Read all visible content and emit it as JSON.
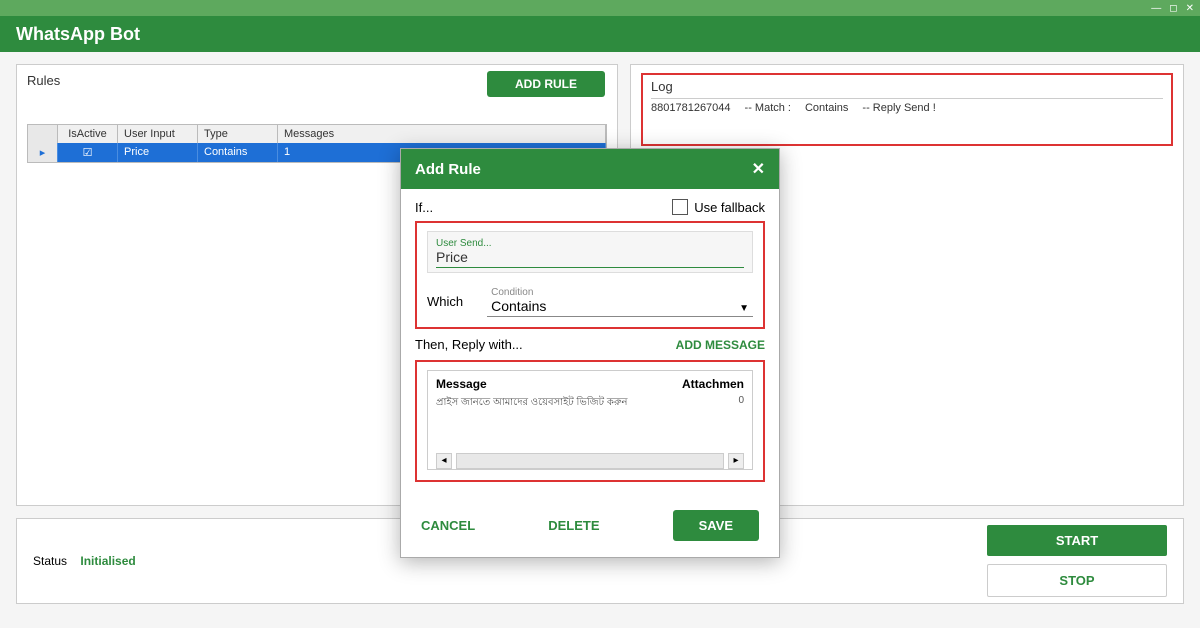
{
  "window": {
    "title": "WhatsApp Bot"
  },
  "rules_panel": {
    "title": "Rules",
    "add_button": "ADD RULE",
    "columns": {
      "is_active": "IsActive",
      "user_input": "User Input",
      "type": "Type",
      "messages": "Messages"
    },
    "rows": [
      {
        "marker": "▸",
        "is_active": "☑",
        "user_input": "Price",
        "type": "Contains",
        "messages": "1"
      }
    ]
  },
  "log_panel": {
    "title": "Log",
    "entries": [
      {
        "number": "8801781267044",
        "match": "-- Match :",
        "cond": "Contains",
        "result": "-- Reply Send !"
      }
    ]
  },
  "footer": {
    "status_label": "Status",
    "status_value": "Initialised",
    "start": "START",
    "stop": "STOP"
  },
  "modal": {
    "title": "Add Rule",
    "if_label": "If...",
    "fallback_label": "Use fallback",
    "user_send_label": "User Send...",
    "user_send_value": "Price",
    "which_label": "Which",
    "condition_small": "Condition",
    "condition_value": "Contains",
    "then_label": "Then, Reply with...",
    "add_message": "ADD MESSAGE",
    "msg_col": "Message",
    "att_col": "Attachmen",
    "msg_text": "প্রাইস জানতে আমাদের ওয়েবসাইট ভিজিট করুন",
    "att_val": "0",
    "cancel": "CANCEL",
    "delete": "DELETE",
    "save": "SAVE"
  }
}
